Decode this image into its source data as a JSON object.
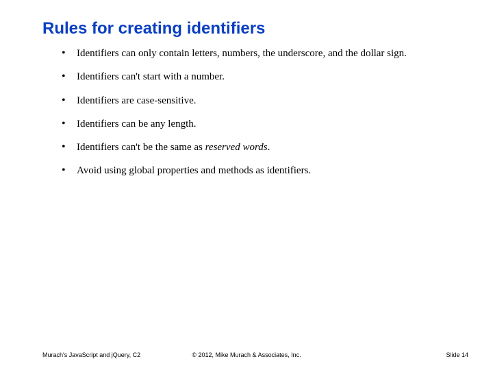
{
  "title": "Rules for creating identifiers",
  "bullets": [
    {
      "html": "Identifiers can only contain letters, numbers, the underscore, and the dollar sign."
    },
    {
      "html": "Identifiers can't start with a number."
    },
    {
      "html": "Identifiers are case-sensitive."
    },
    {
      "html": "Identifiers can be any length."
    },
    {
      "html": "Identifiers can't be the same as <em class=\"kw\">reserved words</em>."
    },
    {
      "html": "Avoid using global properties and methods as identifiers."
    }
  ],
  "footer": {
    "left": "Murach's JavaScript and jQuery, C2",
    "center": "© 2012, Mike Murach & Associates, Inc.",
    "right": "Slide 14"
  }
}
